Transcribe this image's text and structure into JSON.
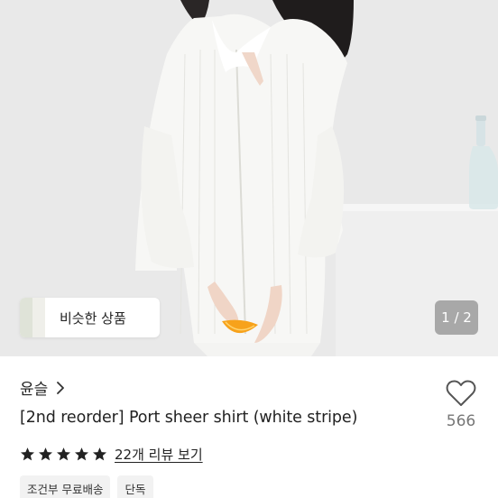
{
  "hero": {
    "similar_products_label": "비슷한 상품",
    "page_indicator": "1 / 2"
  },
  "shop": {
    "name": "윤슬"
  },
  "product": {
    "title": "[2nd reorder] Port sheer shirt (white stripe)",
    "like_count": "566",
    "rating_stars": 5,
    "review_link": "22개 리뷰 보기"
  },
  "tags": [
    "조건부 무료배송",
    "단독"
  ],
  "colors": {
    "star": "#222222",
    "heart_outline": "#555555",
    "tag_bg": "#f2f2f2"
  },
  "icons": {
    "like": "heart-icon",
    "shop_more": "chevron-right-icon",
    "rating": "star-icon"
  }
}
